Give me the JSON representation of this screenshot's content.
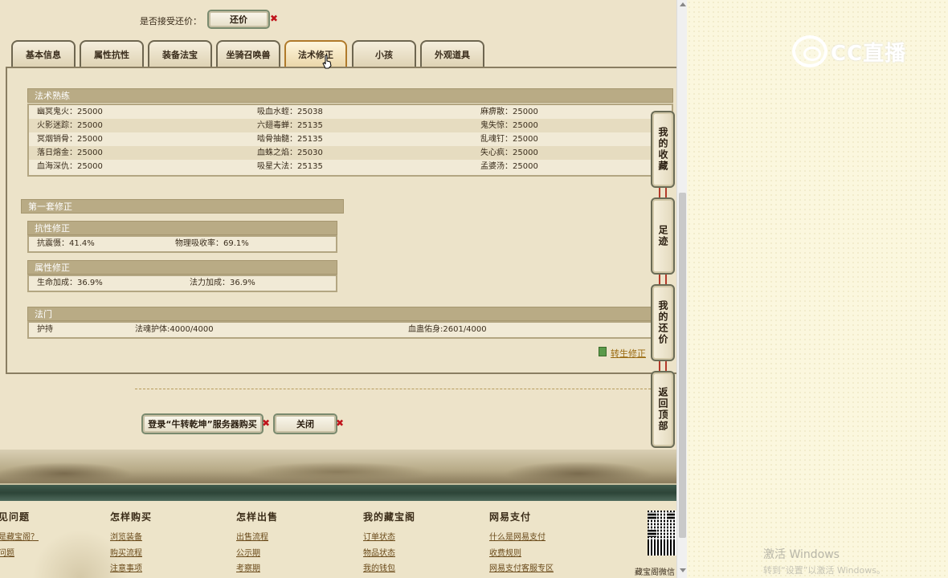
{
  "accept_counter": {
    "label": "是否接受还价：",
    "button": "还价"
  },
  "tabs": [
    {
      "label": "基本信息"
    },
    {
      "label": "属性抗性"
    },
    {
      "label": "装备法宝"
    },
    {
      "label": "坐骑召唤兽"
    },
    {
      "label": "法术修正"
    },
    {
      "label": "小孩"
    },
    {
      "label": "外观道具"
    }
  ],
  "spell_mastery": {
    "title": "法术熟练",
    "rows": [
      [
        "幽冥鬼火：25000",
        "吸血水蛭：25038",
        "麻痹散：25000"
      ],
      [
        "火影迷踪：25000",
        "六翅毒蝉：25135",
        "鬼失惊：25000"
      ],
      [
        "冥烟销骨：25000",
        "啮骨抽髓：25135",
        "乱魂钉：25000"
      ],
      [
        "落日熔金：25000",
        "血蛛之焰：25030",
        "失心疯：25000"
      ],
      [
        "血海深仇：25000",
        "吸星大法：25135",
        "孟婆汤：25000"
      ]
    ]
  },
  "set_one": {
    "title": "第一套修正"
  },
  "resist": {
    "title": "抗性修正",
    "items": [
      "抗震慑：41.4%",
      "物理吸收率：69.1%"
    ]
  },
  "attr": {
    "title": "属性修正",
    "items": [
      "生命加成：36.9%",
      "法力加成：36.9%"
    ]
  },
  "fumen": {
    "title": "法门",
    "items": [
      "护持",
      "法魂护体:4000/4000",
      "血蛊佑身:2601/4000"
    ]
  },
  "rebirth_link": "转生修正",
  "actions": {
    "login": "登录“牛转乾坤”服务器购买",
    "close": "关闭"
  },
  "side_menu": [
    "我的收藏",
    "足迹",
    "我的还价",
    "返回顶部"
  ],
  "footer": {
    "columns": [
      {
        "title": "见问题",
        "links": [
          "是藏宝阁？",
          "问题"
        ]
      },
      {
        "title": "怎样购买",
        "links": [
          "浏览装备",
          "购买流程",
          "注意事项"
        ]
      },
      {
        "title": "怎样出售",
        "links": [
          "出售流程",
          "公示期",
          "考察期"
        ]
      },
      {
        "title": "我的藏宝阁",
        "links": [
          "订单状态",
          "物品状态",
          "我的钱包"
        ]
      },
      {
        "title": "网易支付",
        "links": [
          "什么是网易支付",
          "收费规则",
          "网易支付客服专区"
        ]
      }
    ],
    "qr_label": "藏宝阁微信"
  },
  "overlay": {
    "logo": "CC直播",
    "activate": "激活 Windows",
    "activate_sub": "转到“设置”以激活 Windows。"
  },
  "colors": {
    "header": "#b9ab85",
    "accent_red": "#c0141c",
    "footer_bar": "#2d4538"
  }
}
